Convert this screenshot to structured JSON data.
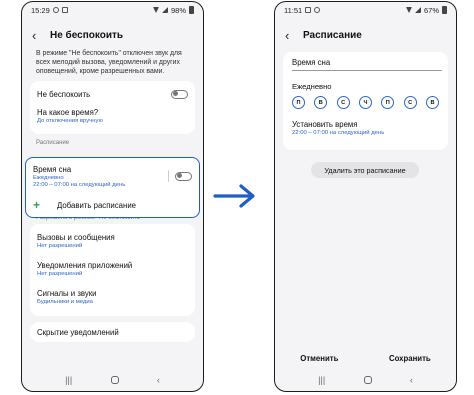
{
  "left": {
    "status_time": "15:29",
    "status_battery": "98%",
    "title": "Не беспокоить",
    "description": "В режиме \"Не беспокоить\" отключен звук для всех мелодий вызова, уведомлений и других оповещений, кроме разрешенных вами.",
    "dnd_label": "Не беспокоить",
    "how_long_label": "На какое время?",
    "how_long_value": "До отключения вручную",
    "schedule_section": "Расписание",
    "sleep_label": "Время сна",
    "sleep_days": "Ежедневно",
    "sleep_time": "22:00 – 07:00 на следующий день",
    "add_schedule": "Добавить расписание",
    "allowed_section": "Разрешено в режиме \"Не беспокоить\"",
    "calls_label": "Вызовы и сообщения",
    "calls_value": "Нет разрешений",
    "app_notif_label": "Уведомления приложений",
    "app_notif_value": "Нет разрешений",
    "alarms_label": "Сигналы и звуки",
    "alarms_value": "Будильники и медиа",
    "hide_notif_label": "Скрытие уведомлений"
  },
  "right": {
    "status_time": "11:51",
    "status_battery": "67%",
    "title": "Расписание",
    "name_value": "Время сна",
    "daily_label": "Ежедневно",
    "days": [
      "П",
      "В",
      "С",
      "Ч",
      "П",
      "С",
      "В"
    ],
    "set_time_label": "Установить время",
    "set_time_value": "22:00 – 07:00 на следующий день",
    "delete_button": "Удалить это расписание",
    "cancel_button": "Отменить",
    "save_button": "Сохранить"
  },
  "colors": {
    "accent_blue": "#2b66c9",
    "highlight_border": "#1f5fc5",
    "add_green": "#2ea44f"
  },
  "icons": {
    "back": "back-arrow-icon",
    "plus": "plus-icon",
    "arrow": "right-arrow-icon"
  }
}
